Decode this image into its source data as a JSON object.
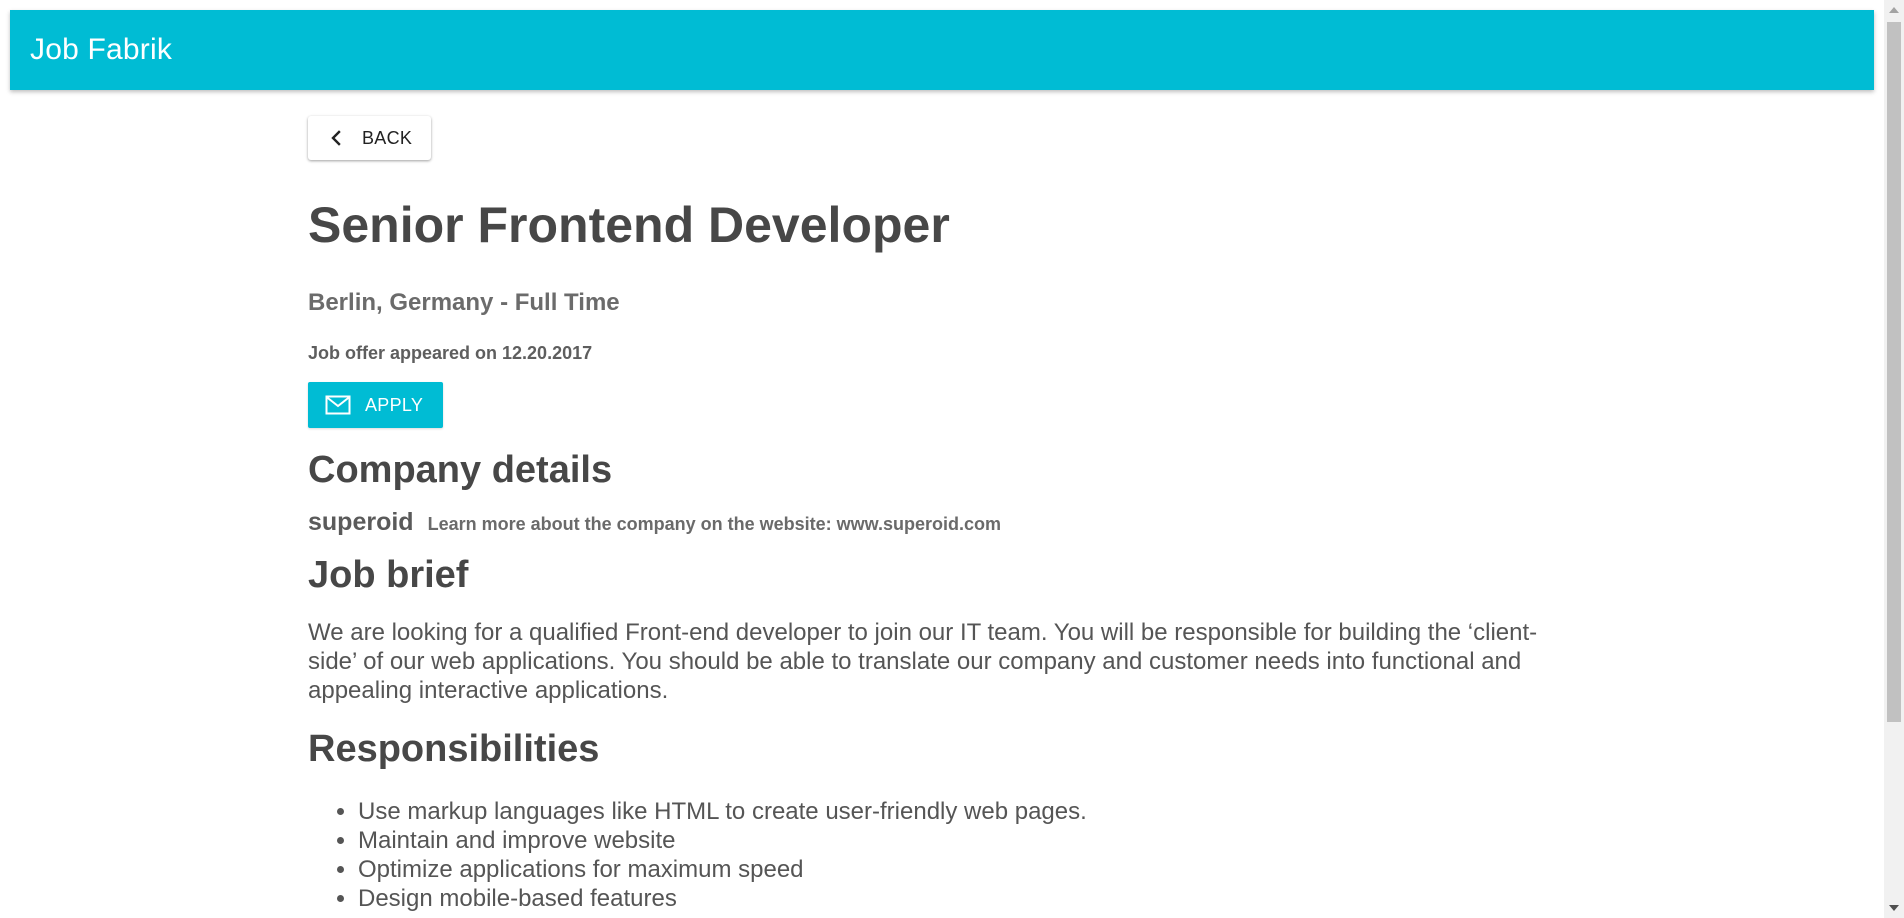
{
  "header": {
    "title": "Job Fabrik"
  },
  "back_button": {
    "label": "BACK",
    "icon": "chevron-left-icon"
  },
  "job": {
    "title": "Senior Frontend Developer",
    "location": "Berlin, Germany - Full Time",
    "posted": "Job offer appeared on 12.20.2017"
  },
  "apply_button": {
    "label": "APPLY",
    "icon": "mail-icon"
  },
  "company": {
    "heading": "Company details",
    "name": "superoid",
    "info": "Learn more about the company on the website: www.superoid.com"
  },
  "brief": {
    "heading": "Job brief",
    "text": "We are looking for a qualified Front-end developer to join our IT team. You will be responsible for building the ‘client-side’ of our web applications. You should be able to translate our company and customer needs into functional and appealing interactive applications."
  },
  "responsibilities": {
    "heading": "Responsibilities",
    "items": [
      "Use markup languages like HTML to create user-friendly web pages.",
      "Maintain and improve website",
      "Optimize applications for maximum speed",
      "Design mobile-based features"
    ]
  },
  "colors": {
    "accent": "#00bcd4",
    "text": "#4a4a4a"
  }
}
